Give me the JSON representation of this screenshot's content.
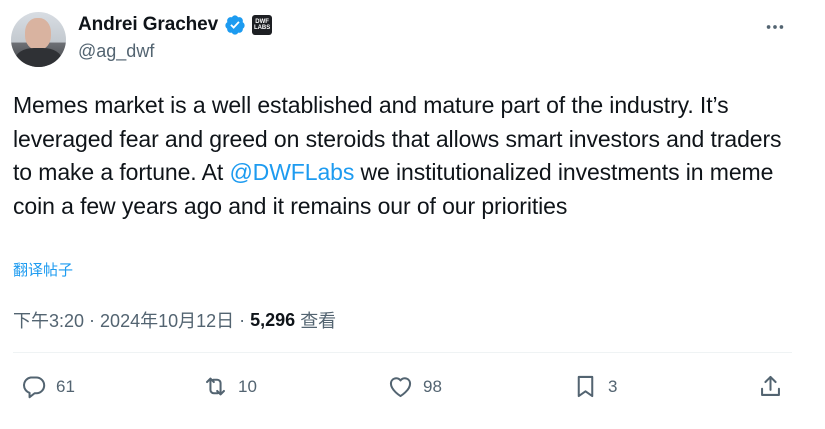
{
  "author": {
    "display_name": "Andrei Grachev",
    "handle": "@ag_dwf",
    "verified_color": "#1d9bf0",
    "affiliate_badge_line1": "DWF",
    "affiliate_badge_line2": "LABS"
  },
  "tweet": {
    "text_before_mention": "Memes market is a well established and mature part of the industry. It’s leveraged fear and greed on steroids that allows smart investors and traders to make a fortune. At ",
    "mention": "@DWFLabs",
    "text_after_mention": " we institutionalized investments in meme coin a few years ago and it remains our of our priorities",
    "translate_label": "翻译帖子"
  },
  "meta": {
    "time": "下午3:20",
    "separator": "·",
    "date": "2024年10月12日",
    "views_count": "5,296",
    "views_label": "查看"
  },
  "actions": {
    "reply": {
      "icon": "reply-icon",
      "count": "61"
    },
    "retweet": {
      "icon": "retweet-icon",
      "count": "10"
    },
    "like": {
      "icon": "heart-icon",
      "count": "98"
    },
    "bookmark": {
      "icon": "bookmark-icon",
      "count": "3"
    },
    "share": {
      "icon": "share-icon"
    }
  },
  "colors": {
    "text": "#0f1419",
    "secondary": "#536471",
    "accent": "#1d9bf0",
    "divider": "#eff3f4"
  }
}
